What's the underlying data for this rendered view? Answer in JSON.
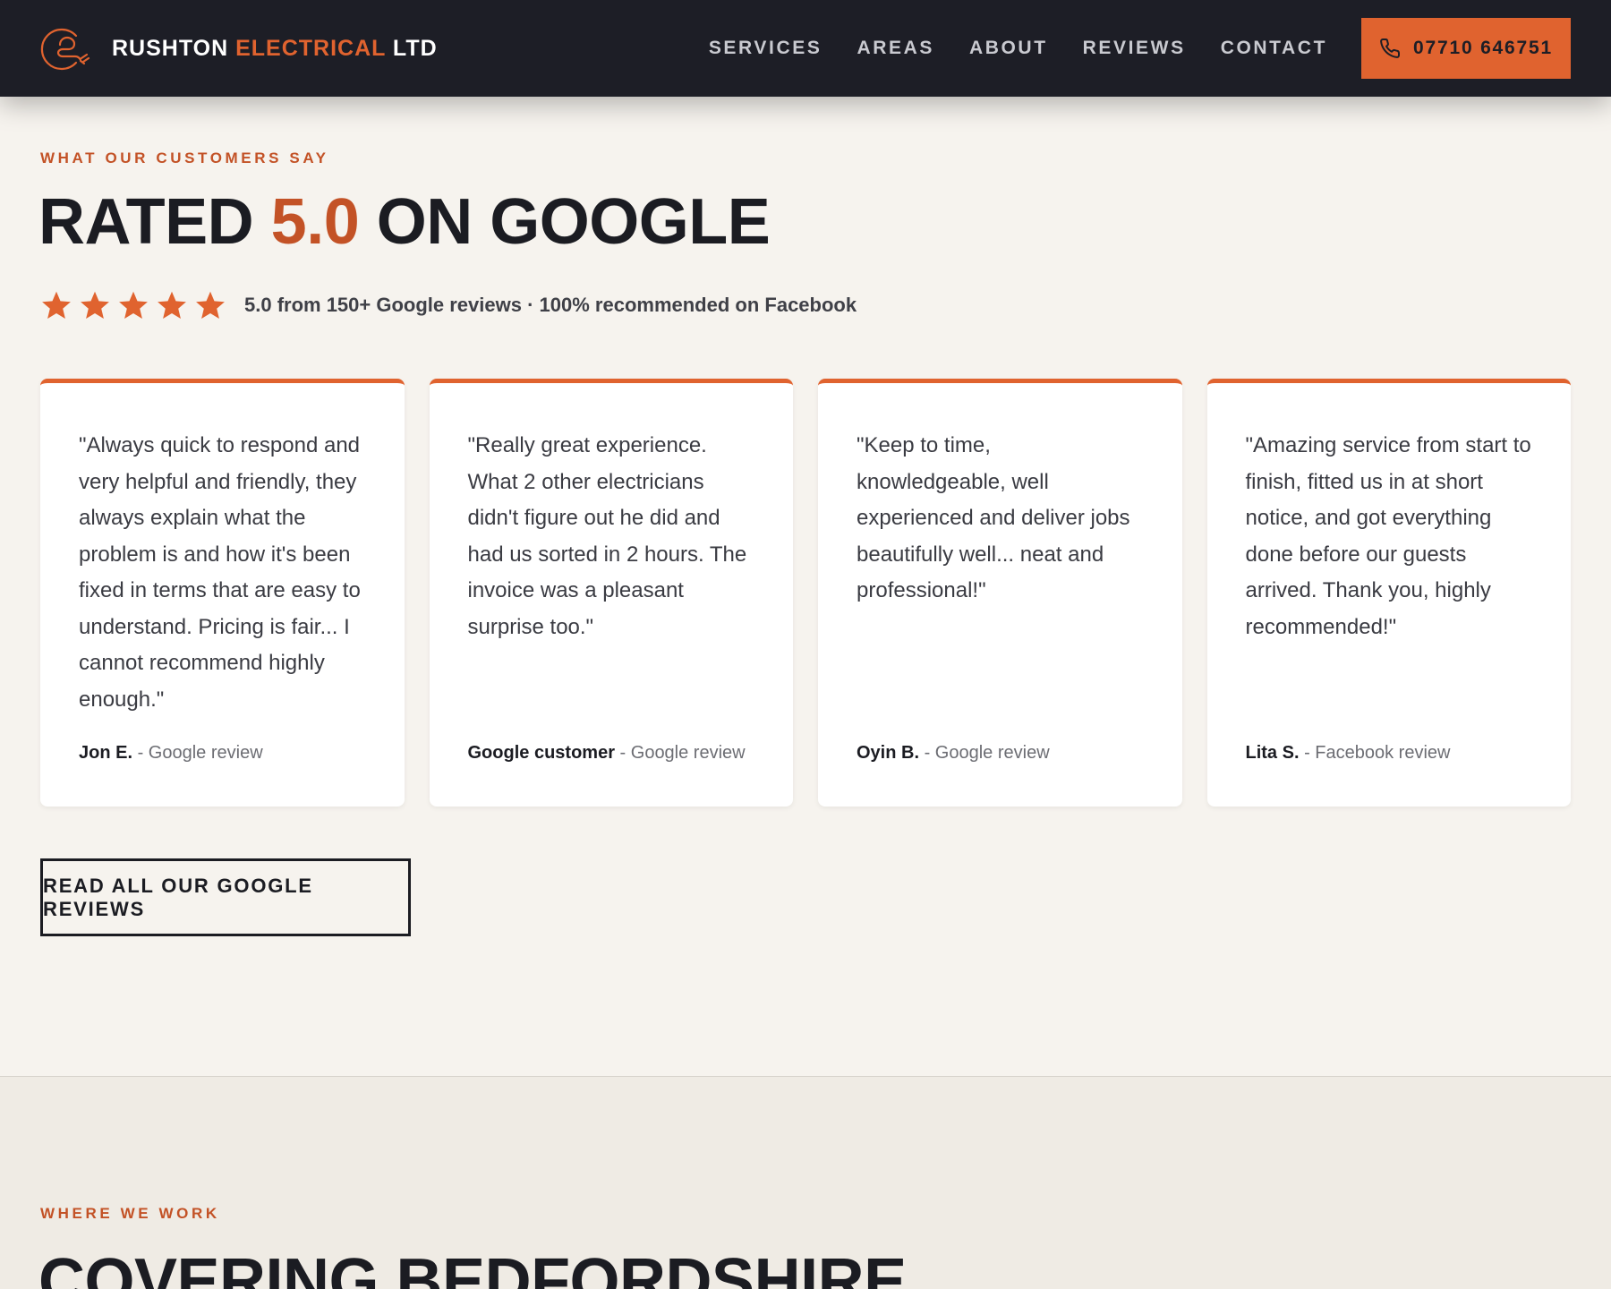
{
  "header": {
    "brand_part1": "RUSHTON ",
    "brand_accent": "ELECTRICAL",
    "brand_part2": " LTD",
    "nav": [
      {
        "label": "SERVICES"
      },
      {
        "label": "AREAS"
      },
      {
        "label": "ABOUT"
      },
      {
        "label": "REVIEWS"
      },
      {
        "label": "CONTACT"
      }
    ],
    "phone": "07710 646751"
  },
  "reviews": {
    "eyebrow": "WHAT OUR CUSTOMERS SAY",
    "title_part1": "RATED ",
    "title_accent": "5.0",
    "title_part2": " ON GOOGLE",
    "rating_stars": 5,
    "rating_text": "5.0 from 150+ Google reviews · 100% recommended on Facebook",
    "cards": [
      {
        "quote": "\"Always quick to respond and very helpful and friendly, they always explain what the problem is and how it's been fixed in terms that are easy to understand. Pricing is fair... I cannot recommend highly enough.\"",
        "name": "Jon E.",
        "source": " - Google review"
      },
      {
        "quote": "\"Really great experience. What 2 other electricians didn't figure out he did and had us sorted in 2 hours. The invoice was a pleasant surprise too.\"",
        "name": "Google customer",
        "source": " - Google review"
      },
      {
        "quote": "\"Keep to time, knowledgeable, well experienced and deliver jobs beautifully well... neat and professional!\"",
        "name": "Oyin B.",
        "source": " - Google review"
      },
      {
        "quote": "\"Amazing service from start to finish, fitted us in at short notice, and got everything done before our guests arrived. Thank you, highly recommended!\"",
        "name": "Lita S.",
        "source": " - Facebook review"
      }
    ],
    "cta": "READ ALL OUR GOOGLE REVIEWS"
  },
  "areas": {
    "eyebrow": "WHERE WE WORK",
    "title": "COVERING BEDFORDSHIRE"
  },
  "colors": {
    "accent": "#e0632f",
    "accent_dark": "#c35226",
    "header_bg": "#1d1e26",
    "page_bg": "#f6f3ee"
  }
}
